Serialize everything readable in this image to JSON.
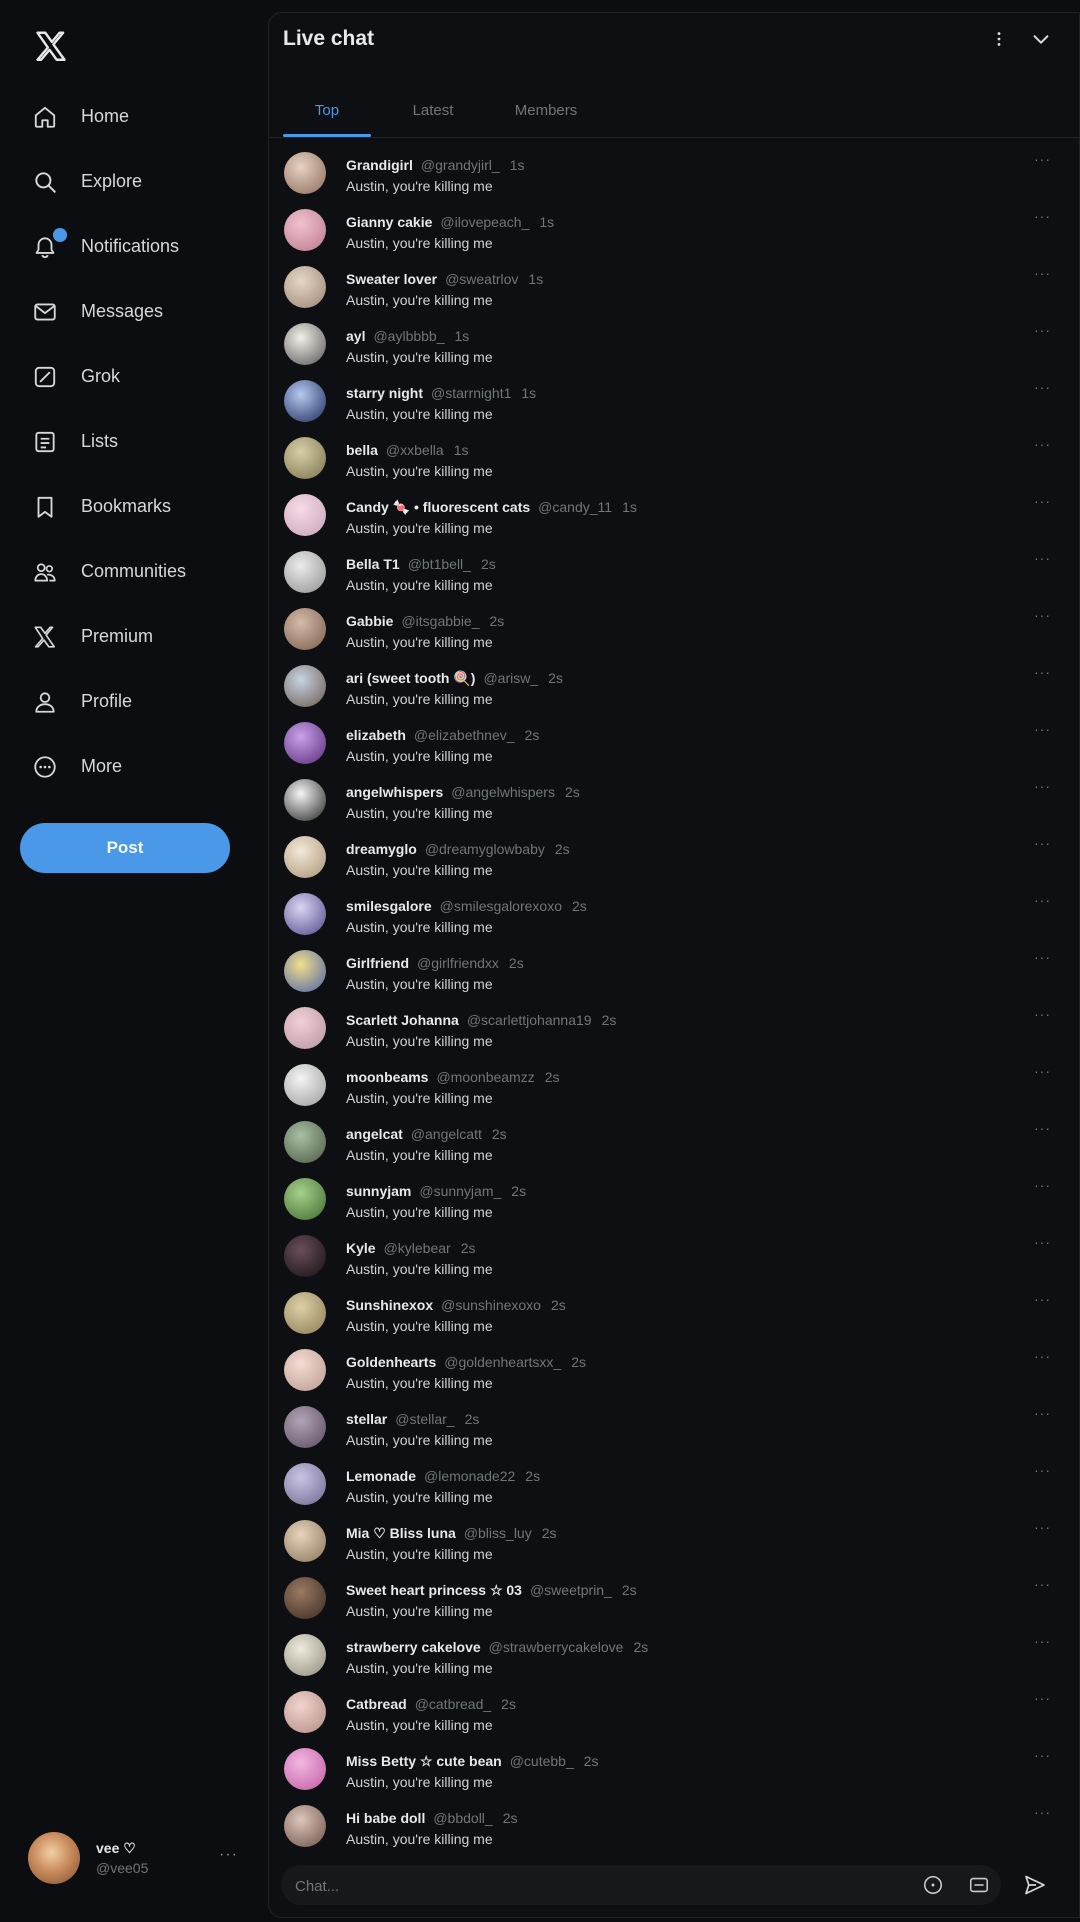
{
  "brand": {
    "logo": "x-logo-icon"
  },
  "nav": {
    "items": [
      {
        "label": "Home",
        "icon": "home-icon"
      },
      {
        "label": "Explore",
        "icon": "search-icon"
      },
      {
        "label": "Notifications",
        "icon": "bell-icon",
        "badge": true
      },
      {
        "label": "Messages",
        "icon": "envelope-icon"
      },
      {
        "label": "Grok",
        "icon": "grok-icon"
      },
      {
        "label": "Lists",
        "icon": "list-icon"
      },
      {
        "label": "Bookmarks",
        "icon": "bookmark-icon"
      },
      {
        "label": "Communities",
        "icon": "communities-icon"
      },
      {
        "label": "Premium",
        "icon": "x-premium-icon"
      },
      {
        "label": "Profile",
        "icon": "person-icon"
      },
      {
        "label": "More",
        "icon": "more-circle-icon"
      }
    ],
    "post_label": "Post"
  },
  "account": {
    "name": "vee ♡",
    "handle": "@vee05"
  },
  "chat": {
    "title": "Live chat",
    "tabs": [
      {
        "label": "Top",
        "active": true
      },
      {
        "label": "Latest",
        "active": false
      },
      {
        "label": "Members",
        "active": false
      }
    ],
    "composer_placeholder": "Chat...",
    "messages": [
      {
        "name": "Grandigirl",
        "handle": "@grandyjirl_",
        "time": "1s",
        "text": "Austin, you're killing me",
        "avatar": [
          "#e8d2c2",
          "#8a6a5a"
        ]
      },
      {
        "name": "Gianny cakie",
        "handle": "@ilovepeach_",
        "time": "1s",
        "text": "Austin, you're killing me",
        "avatar": [
          "#f2c2cf",
          "#b8798a"
        ]
      },
      {
        "name": "Sweater lover",
        "handle": "@sweatrlov",
        "time": "1s",
        "text": "Austin, you're killing me",
        "avatar": [
          "#e6d6c6",
          "#9a8574"
        ]
      },
      {
        "name": "ayl",
        "handle": "@aylbbbb_",
        "time": "1s",
        "text": "Austin, you're killing me",
        "avatar": [
          "#f3efe8",
          "#545454"
        ]
      },
      {
        "name": "starry night",
        "handle": "@starrnight1",
        "time": "1s",
        "text": "Austin, you're killing me",
        "avatar": [
          "#b7c9f2",
          "#1c2a5a"
        ]
      },
      {
        "name": "bella",
        "handle": "@xxbella",
        "time": "1s",
        "text": "Austin, you're killing me",
        "avatar": [
          "#d8cfa8",
          "#7a724a"
        ]
      },
      {
        "name": "Candy 🍬 • fluorescent cats",
        "handle": "@candy_11",
        "time": "1s",
        "text": "Austin, you're killing me",
        "avatar": [
          "#f7dbe8",
          "#c7a3b8"
        ]
      },
      {
        "name": "Bella T1",
        "handle": "@bt1bell_",
        "time": "2s",
        "text": "Austin, you're killing me",
        "avatar": [
          "#ececec",
          "#8e8e8e"
        ]
      },
      {
        "name": "Gabbie",
        "handle": "@itsgabbie_",
        "time": "2s",
        "text": "Austin, you're killing me",
        "avatar": [
          "#d6bba9",
          "#7a5c4c"
        ]
      },
      {
        "name": "ari (sweet tooth 🍭)",
        "handle": "@arisw_",
        "time": "2s",
        "text": "Austin, you're killing me",
        "avatar": [
          "#c8d3e3",
          "#6a5a4e"
        ]
      },
      {
        "name": "elizabeth",
        "handle": "@elizabethnev_",
        "time": "2s",
        "text": "Austin, you're killing me",
        "avatar": [
          "#c9a2e8",
          "#5a2a7a"
        ]
      },
      {
        "name": "angelwhispers",
        "handle": "@angelwhispers",
        "time": "2s",
        "text": "Austin, you're killing me",
        "avatar": [
          "#f5f5f5",
          "#222222"
        ]
      },
      {
        "name": "dreamyglo",
        "handle": "@dreamyglowbaby",
        "time": "2s",
        "text": "Austin, you're killing me",
        "avatar": [
          "#f3ead8",
          "#a89274"
        ]
      },
      {
        "name": "smilesgalore",
        "handle": "@smilesgalorexoxo",
        "time": "2s",
        "text": "Austin, you're killing me",
        "avatar": [
          "#dcd4f2",
          "#4d4a8a"
        ]
      },
      {
        "name": "Girlfriend",
        "handle": "@girlfriendxx",
        "time": "2s",
        "text": "Austin, you're killing me",
        "avatar": [
          "#f2de8c",
          "#4a62a8"
        ]
      },
      {
        "name": "Scarlett Johanna",
        "handle": "@scarlettjohanna19",
        "time": "2s",
        "text": "Austin, you're killing me",
        "avatar": [
          "#f0d0d8",
          "#b8949e"
        ]
      },
      {
        "name": "moonbeams",
        "handle": "@moonbeamzz",
        "time": "2s",
        "text": "Austin, you're killing me",
        "avatar": [
          "#f4f4f4",
          "#9a9a9a"
        ]
      },
      {
        "name": "angelcat",
        "handle": "@angelcatt",
        "time": "2s",
        "text": "Austin, you're killing me",
        "avatar": [
          "#a9bfa4",
          "#4a5a44"
        ]
      },
      {
        "name": "sunnyjam",
        "handle": "@sunnyjam_",
        "time": "2s",
        "text": "Austin, you're killing me",
        "avatar": [
          "#a6d08c",
          "#3e6a2e"
        ]
      },
      {
        "name": "Kyle",
        "handle": "@kylebear",
        "time": "2s",
        "text": "Austin, you're killing me",
        "avatar": [
          "#6a4e5a",
          "#141014"
        ]
      },
      {
        "name": "Sunshinexox",
        "handle": "@sunshinexoxo",
        "time": "2s",
        "text": "Austin, you're killing me",
        "avatar": [
          "#ddd0a6",
          "#8a7a54"
        ]
      },
      {
        "name": "Goldenhearts",
        "handle": "@goldenheartsxx_",
        "time": "2s",
        "text": "Austin, you're killing me",
        "avatar": [
          "#f4dcd4",
          "#b89a8e"
        ]
      },
      {
        "name": "stellar",
        "handle": "@stellar_",
        "time": "2s",
        "text": "Austin, you're killing me",
        "avatar": [
          "#b4a4b8",
          "#5a4a5e"
        ]
      },
      {
        "name": "Lemonade",
        "handle": "@lemonade22",
        "time": "2s",
        "text": "Austin, you're killing me",
        "avatar": [
          "#cac4e4",
          "#6e688e"
        ]
      },
      {
        "name": "Mia ♡ Bliss luna",
        "handle": "@bliss_luy",
        "time": "2s",
        "text": "Austin, you're killing me",
        "avatar": [
          "#e6d4bc",
          "#8a745a"
        ]
      },
      {
        "name": "Sweet heart princess ☆ 03",
        "handle": "@sweetprin_",
        "time": "2s",
        "text": "Austin, you're killing me",
        "avatar": [
          "#9a7a62",
          "#3a2a22"
        ]
      },
      {
        "name": "strawberry cakelove",
        "handle": "@strawberrycakelove",
        "time": "2s",
        "text": "Austin, you're killing me",
        "avatar": [
          "#eeeadc",
          "#8e8a7c"
        ]
      },
      {
        "name": "Catbread",
        "handle": "@catbread_",
        "time": "2s",
        "text": "Austin, you're killing me",
        "avatar": [
          "#f2d4ce",
          "#b08c84"
        ]
      },
      {
        "name": "Miss Betty ☆ cute bean",
        "handle": "@cutebb_",
        "time": "2s",
        "text": "Austin, you're killing me",
        "avatar": [
          "#f2b8e2",
          "#c05aa2"
        ]
      },
      {
        "name": "Hi babe doll",
        "handle": "@bbdoll_",
        "time": "2s",
        "text": "Austin, you're killing me",
        "avatar": [
          "#dcc6bc",
          "#6e5048"
        ]
      }
    ]
  }
}
